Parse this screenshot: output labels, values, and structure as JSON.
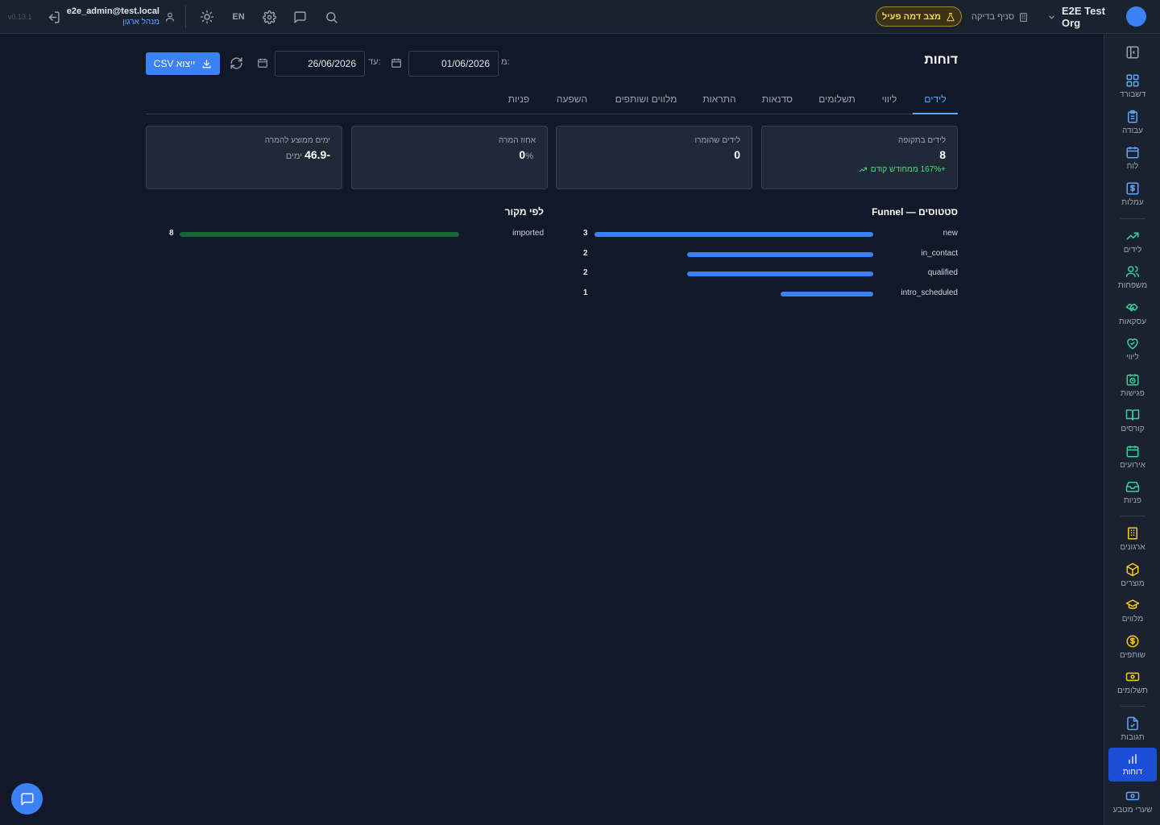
{
  "app": {
    "version": "v0.13.1",
    "user_email": "e2e_admin@test.local",
    "user_role": "מנהל ארגון",
    "lang_toggle": "EN",
    "mock_mode_label": "מצב דמה פעיל",
    "branch_label": "סניף בדיקה",
    "org_name": "E2E Test Org",
    "accent_color": "#3b82f6"
  },
  "sidebar": {
    "items": [
      {
        "label": "דשבורד",
        "icon": "dashboard-icon"
      },
      {
        "label": "עבודה",
        "icon": "clipboard-icon"
      },
      {
        "label": "לוח",
        "icon": "calendar-icon"
      },
      {
        "label": "עמלות",
        "icon": "dollar-icon"
      },
      {
        "label": "לידים",
        "icon": "trending-up-icon"
      },
      {
        "label": "משפחות",
        "icon": "users-icon"
      },
      {
        "label": "עסקאות",
        "icon": "handshake-icon"
      },
      {
        "label": "ליווי",
        "icon": "heart-handshake-icon"
      },
      {
        "label": "פגישות",
        "icon": "calendar-clock-icon"
      },
      {
        "label": "קורסים",
        "icon": "book-icon"
      },
      {
        "label": "אירועים",
        "icon": "calendar-days-icon"
      },
      {
        "label": "פניות",
        "icon": "inbox-icon"
      },
      {
        "label": "ארגונים",
        "icon": "building-icon"
      },
      {
        "label": "מוצרים",
        "icon": "package-icon"
      },
      {
        "label": "מלווים",
        "icon": "graduation-cap-icon"
      },
      {
        "label": "שותפים",
        "icon": "coin-icon"
      },
      {
        "label": "תשלומים",
        "icon": "banknote-icon"
      },
      {
        "label": "תגובות",
        "icon": "file-check-icon"
      },
      {
        "label": "דוחות",
        "icon": "bar-chart-icon",
        "active": true
      },
      {
        "label": "שערי מטבע",
        "icon": "currency-icon"
      }
    ]
  },
  "page": {
    "title": "דוחות",
    "from_label": "מ:",
    "from_date": "01/06/2026",
    "to_label": "עד:",
    "to_date": "26/06/2026",
    "export_label": "ייצוא CSV"
  },
  "tabs": [
    "לידים",
    "ליווי",
    "תשלומים",
    "סדנאות",
    "התראות",
    "מלווים ושותפים",
    "השפעה",
    "פניות"
  ],
  "active_tab": "לידים",
  "kpis": [
    {
      "title": "לידים בתקופה",
      "value": "8",
      "trend": "+167% ממחודש קודם"
    },
    {
      "title": "לידים שהומרו",
      "value": "0"
    },
    {
      "title": "אחוז המרה",
      "value": "0",
      "unit": "%"
    },
    {
      "title": "ימים ממוצע להמרה",
      "value": "-46.9",
      "unit": "ימים"
    }
  ],
  "funnel": {
    "title": "Funnel — סטטוסים",
    "bar_color": "#3b82f6",
    "max": 3,
    "rows": [
      {
        "label": "new",
        "value": 3
      },
      {
        "label": "in_contact",
        "value": 2
      },
      {
        "label": "qualified",
        "value": 2
      },
      {
        "label": "intro_scheduled",
        "value": 1
      }
    ]
  },
  "by_source": {
    "title": "לפי מקור",
    "bar_color": "#166534",
    "max": 8,
    "rows": [
      {
        "label": "imported",
        "value": 8
      }
    ]
  }
}
